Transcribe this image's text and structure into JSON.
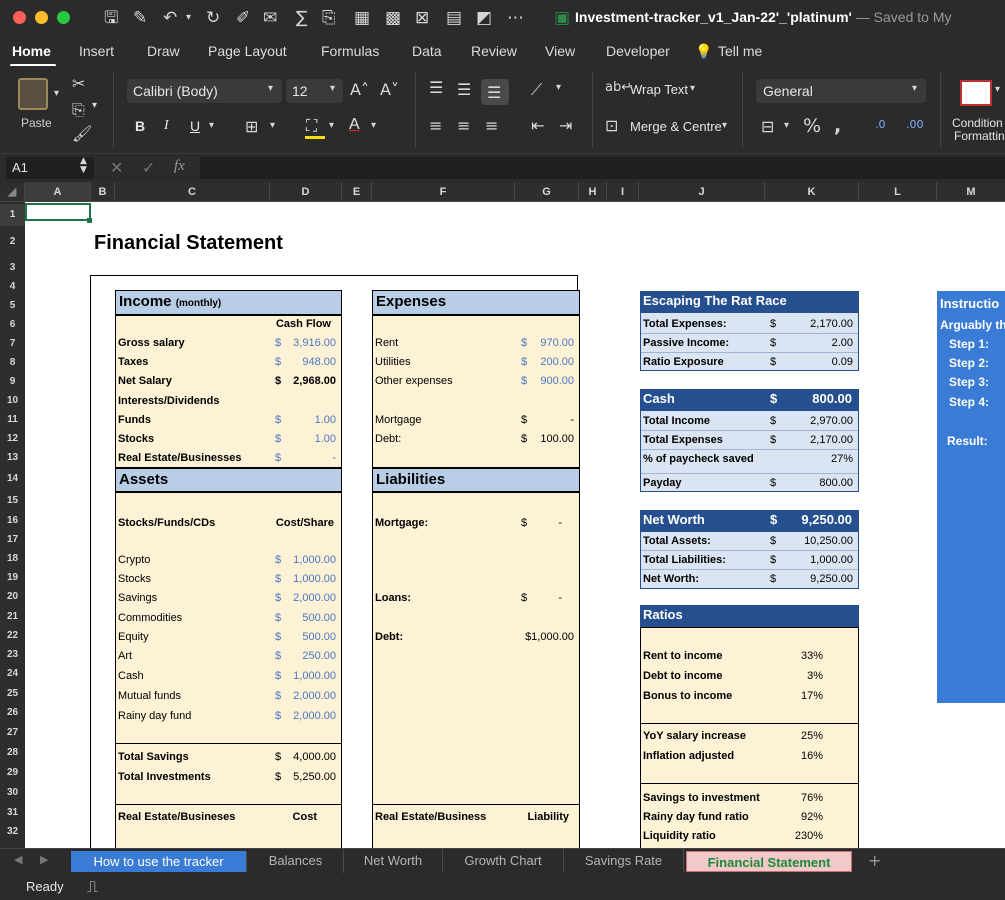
{
  "window": {
    "title": "Investment-tracker_v1_Jan-22'_'platinum'",
    "status": " — Saved to My",
    "colors": {
      "close": "#fe5f57",
      "minimize": "#febc2e",
      "maximize": "#28c840"
    }
  },
  "menu": [
    "Home",
    "Insert",
    "Draw",
    "Page Layout",
    "Formulas",
    "Data",
    "Review",
    "View",
    "Developer",
    "Tell me"
  ],
  "ribbon": {
    "paste": "Paste",
    "font_name": "Calibri (Body)",
    "font_size": "12",
    "wrap_text": "Wrap Text",
    "merge_centre": "Merge & Centre",
    "number_format": "General",
    "conditional": [
      "Condition",
      "Formattin"
    ],
    "bold": "B",
    "italic": "I",
    "underline": "U"
  },
  "formula_bar": {
    "cell_ref": "A1",
    "fx": "fx",
    "content": ""
  },
  "columns": [
    "A",
    "B",
    "C",
    "D",
    "E",
    "F",
    "G",
    "H",
    "I",
    "J",
    "K",
    "L",
    "M"
  ],
  "rows": [
    "1",
    "2",
    "3",
    "4",
    "5",
    "6",
    "7",
    "8",
    "9",
    "10",
    "11",
    "12",
    "13",
    "14",
    "15",
    "16",
    "17",
    "18",
    "19",
    "20",
    "21",
    "22",
    "23",
    "24",
    "25",
    "26",
    "27",
    "28",
    "29",
    "30",
    "31",
    "32"
  ],
  "sheet": {
    "title": "Financial Statement",
    "income": {
      "header": "Income",
      "header_sub": "(monthly)",
      "cash_flow": "Cash Flow",
      "rows": [
        {
          "label": "Gross salary",
          "cur": "$",
          "val": "3,916.00"
        },
        {
          "label": "Taxes",
          "cur": "$",
          "val": "948.00"
        },
        {
          "label": "Net Salary",
          "cur": "$",
          "val": "2,968.00"
        },
        {
          "label": "Interests/Dividends",
          "cur": "",
          "val": ""
        },
        {
          "label": "Funds",
          "cur": "$",
          "val": "1.00"
        },
        {
          "label": "Stocks",
          "cur": "$",
          "val": "1.00"
        },
        {
          "label": "Real Estate/Businesses",
          "cur": "$",
          "val": "-"
        }
      ]
    },
    "expenses": {
      "header": "Expenses",
      "rows": [
        {
          "label": "Rent",
          "cur": "$",
          "val": "970.00"
        },
        {
          "label": "Utilities",
          "cur": "$",
          "val": "200.00"
        },
        {
          "label": "Other expenses",
          "cur": "$",
          "val": "900.00"
        },
        {
          "label": "Mortgage",
          "cur": "$",
          "val": "-"
        },
        {
          "label": "Debt:",
          "cur": "$",
          "val": "100.00"
        }
      ]
    },
    "assets": {
      "header": "Assets",
      "col1": "Stocks/Funds/CDs",
      "col2": "Cost/Share",
      "rows": [
        {
          "label": "Crypto",
          "cur": "$",
          "val": "1,000.00"
        },
        {
          "label": "Stocks",
          "cur": "$",
          "val": "1,000.00"
        },
        {
          "label": "Savings",
          "cur": "$",
          "val": "2,000.00"
        },
        {
          "label": "Commodities",
          "cur": "$",
          "val": "500.00"
        },
        {
          "label": "Equity",
          "cur": "$",
          "val": "500.00"
        },
        {
          "label": "Art",
          "cur": "$",
          "val": "250.00"
        },
        {
          "label": "Cash",
          "cur": "$",
          "val": "1,000.00"
        },
        {
          "label": "Mutual funds",
          "cur": "$",
          "val": "2,000.00"
        },
        {
          "label": "Rainy day fund",
          "cur": "$",
          "val": "2,000.00"
        }
      ],
      "total_savings": {
        "label": "Total Savings",
        "cur": "$",
        "val": "4,000.00"
      },
      "total_investments": {
        "label": "Total Investments",
        "cur": "$",
        "val": "5,250.00"
      },
      "re_label": "Real Estate/Busineses",
      "re_cost": "Cost"
    },
    "liabilities": {
      "header": "Liabilities",
      "mortgage": {
        "label": "Mortgage:",
        "cur": "$",
        "val": "-"
      },
      "loans": {
        "label": "Loans:",
        "cur": "$",
        "val": "-"
      },
      "debt": {
        "label": "Debt:",
        "val": "$1,000.00"
      },
      "re_label": "Real Estate/Business",
      "re_liab": "Liability"
    },
    "rat_race": {
      "header": "Escaping The Rat Race",
      "rows": [
        {
          "label": "Total Expenses:",
          "cur": "$",
          "val": "2,170.00"
        },
        {
          "label": "Passive Income:",
          "cur": "$",
          "val": "2.00"
        },
        {
          "label": "Ratio Exposure",
          "cur": "$",
          "val": "0.09"
        }
      ]
    },
    "cash": {
      "header": "Cash",
      "cur": "$",
      "val": "800.00",
      "rows": [
        {
          "label": "Total Income",
          "cur": "$",
          "val": "2,970.00"
        },
        {
          "label": "Total Expenses",
          "cur": "$",
          "val": "2,170.00"
        },
        {
          "label": "% of paycheck saved",
          "cur": "",
          "val": "27%"
        },
        {
          "label": "Payday",
          "cur": "$",
          "val": "800.00"
        }
      ]
    },
    "net_worth": {
      "header": "Net Worth",
      "cur": "$",
      "val": "9,250.00",
      "rows": [
        {
          "label": "Total Assets:",
          "cur": "$",
          "val": "10,250.00"
        },
        {
          "label": "Total Liabilities:",
          "cur": "$",
          "val": "1,000.00"
        },
        {
          "label": "Net Worth:",
          "cur": "$",
          "val": "9,250.00"
        }
      ]
    },
    "ratios": {
      "header": "Ratios",
      "group1": [
        {
          "label": "Rent to income",
          "val": "33%"
        },
        {
          "label": "Debt to income",
          "val": "3%"
        },
        {
          "label": "Bonus to income",
          "val": "17%"
        }
      ],
      "group2": [
        {
          "label": "YoY salary increase",
          "val": "25%"
        },
        {
          "label": "Inflation adjusted",
          "val": "16%"
        }
      ],
      "group3": [
        {
          "label": "Savings to investment",
          "val": "76%"
        },
        {
          "label": "Rainy day fund ratio",
          "val": "92%"
        },
        {
          "label": "Liquidity ratio",
          "val": "230%"
        }
      ]
    },
    "instructions": {
      "header": "Instructio",
      "line1": "Arguably th",
      "steps": [
        "Step 1:",
        "Step 2:",
        "Step 3:",
        "Step 4:"
      ],
      "result": "Result:"
    }
  },
  "tabs": [
    {
      "label": "How to use the tracker",
      "state": "blue"
    },
    {
      "label": "Balances",
      "state": "normal"
    },
    {
      "label": "Net Worth",
      "state": "normal"
    },
    {
      "label": "Growth Chart",
      "state": "normal"
    },
    {
      "label": "Savings Rate",
      "state": "normal"
    },
    {
      "label": "Financial Statement",
      "state": "active"
    }
  ],
  "add_sheet": "+",
  "status": "Ready"
}
